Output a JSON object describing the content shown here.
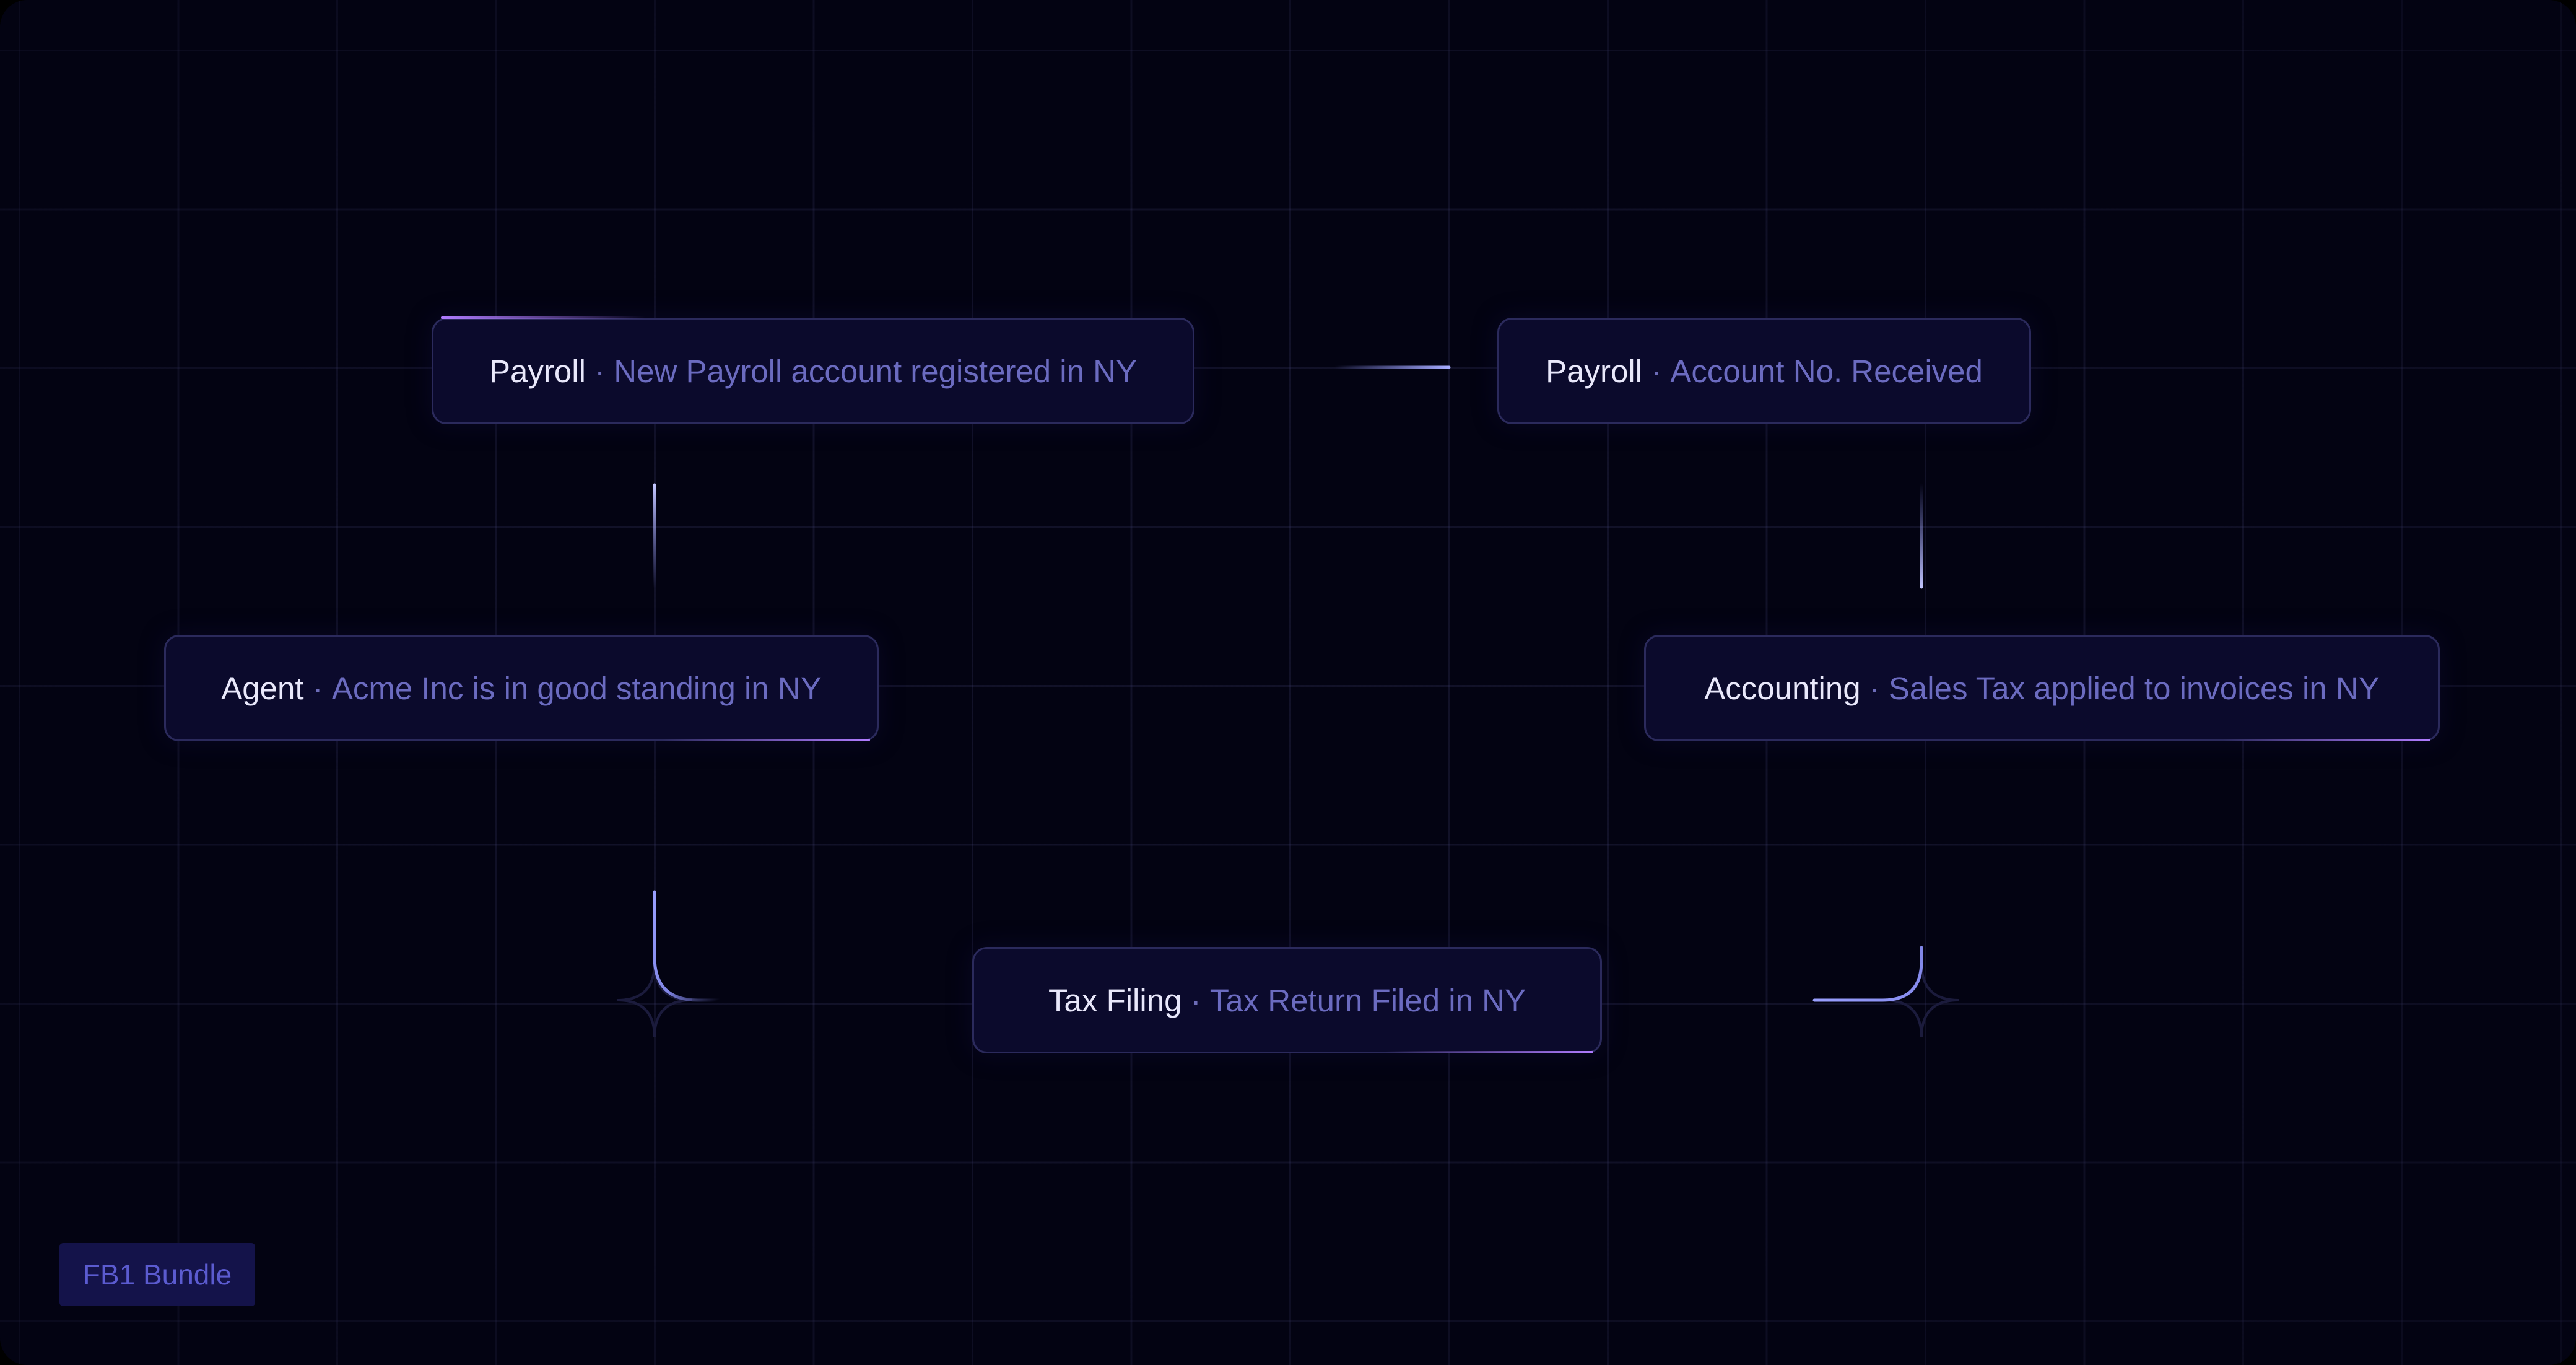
{
  "diagram": {
    "nodes": [
      {
        "id": "payroll-registered",
        "category": "Payroll",
        "separator": "·",
        "description": "New Payroll account registered in NY"
      },
      {
        "id": "payroll-account",
        "category": "Payroll",
        "separator": "·",
        "description": "Account No. Received"
      },
      {
        "id": "agent-standing",
        "category": "Agent",
        "separator": "·",
        "description": "Acme Inc is in good standing in NY"
      },
      {
        "id": "accounting-tax",
        "category": "Accounting",
        "separator": "·",
        "description": "Sales Tax applied to invoices in NY"
      },
      {
        "id": "tax-filing",
        "category": "Tax Filing",
        "separator": "·",
        "description": "Tax Return Filed in NY"
      }
    ],
    "edges": [
      {
        "from": "payroll-registered",
        "to": "payroll-account"
      },
      {
        "from": "payroll-account",
        "to": "accounting-tax"
      },
      {
        "from": "payroll-registered",
        "to": "agent-standing"
      },
      {
        "from": "agent-standing",
        "to": "tax-filing"
      },
      {
        "from": "accounting-tax",
        "to": "tax-filing"
      }
    ]
  },
  "badge": {
    "label": "FB1 Bundle"
  },
  "colors": {
    "background": "#030312",
    "node_fill": "#0b0a2c",
    "node_border": "#2b2a5c",
    "category_text": "#e9e8fb",
    "description_text": "#6b6bc0",
    "accent_purple": "#a86bff",
    "accent_blue": "#8f95ff",
    "badge_fill": "#14134a",
    "badge_text": "#5b5bd0"
  }
}
